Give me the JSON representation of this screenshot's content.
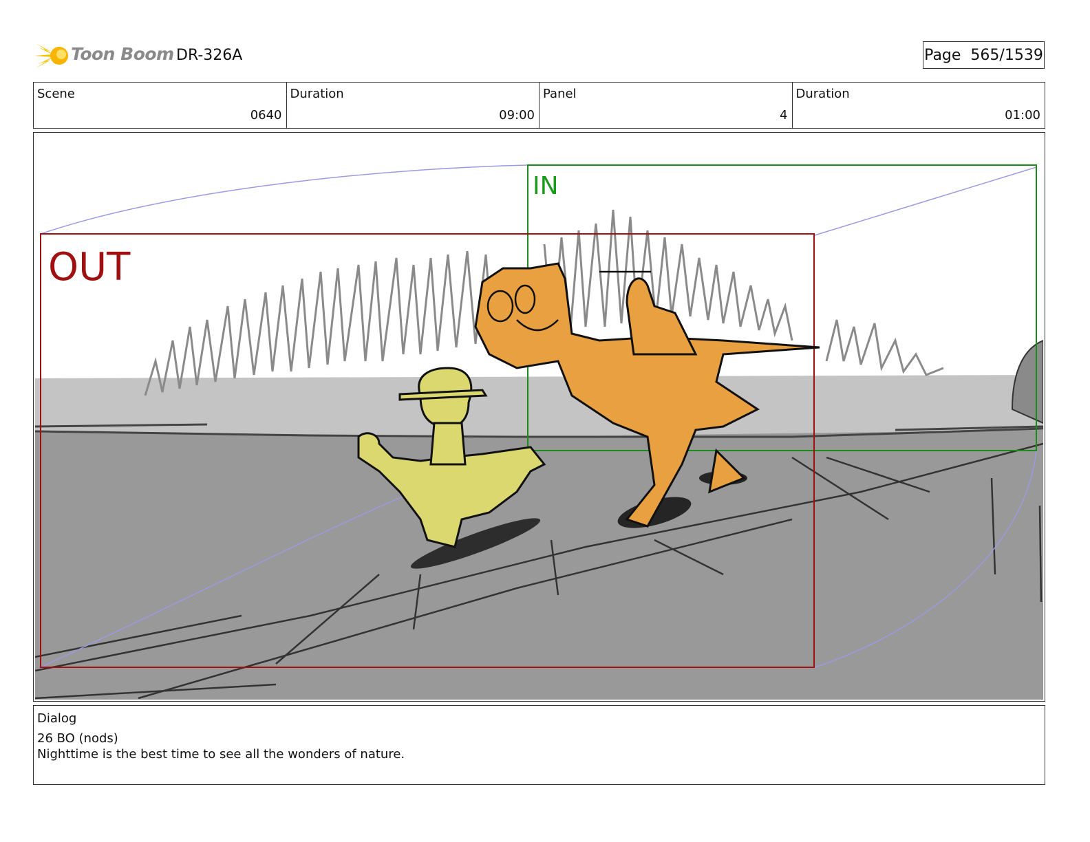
{
  "header": {
    "logo_text": "Toon Boom",
    "production_code": "DR-326A",
    "page_indicator": "Page  565/1539"
  },
  "info": {
    "scene_label": "Scene",
    "scene_value": "0640",
    "scene_duration_label": "Duration",
    "scene_duration_value": "09:00",
    "panel_label": "Panel",
    "panel_value": "4",
    "panel_duration_label": "Duration",
    "panel_duration_value": "01:00"
  },
  "panel": {
    "out_label": "OUT",
    "in_label": "IN",
    "colors": {
      "out_frame": "#a01010",
      "in_frame": "#1a8a1a",
      "camera_path": "#9a9ae0",
      "orange_character": "#e8a040",
      "yellow_character": "#dcd870",
      "ground": "#999999"
    }
  },
  "dialog": {
    "label": "Dialog",
    "line1": "26 BO (nods)",
    "line2": "Nighttime is the best time to see all the wonders of nature."
  }
}
